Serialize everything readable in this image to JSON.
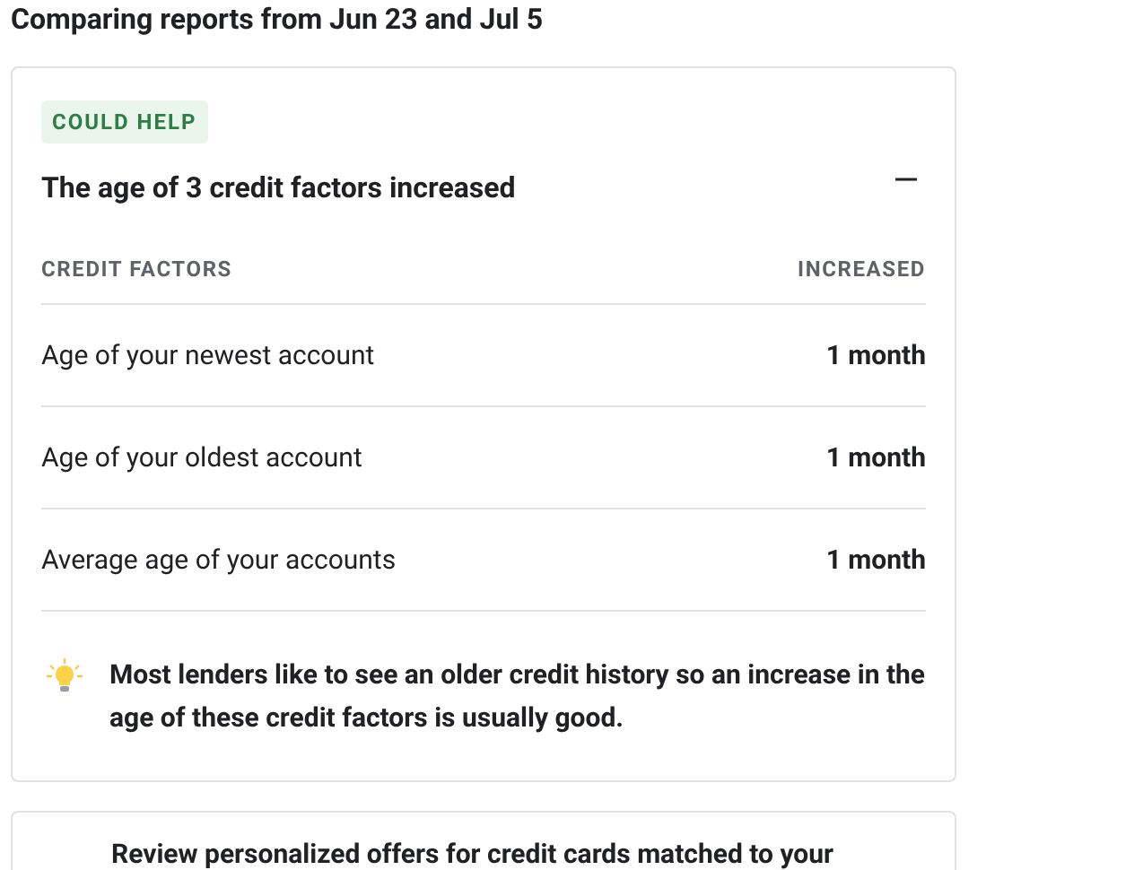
{
  "heading": "Comparing reports from Jun 23 and Jul 5",
  "card": {
    "badge": "COULD HELP",
    "title": "The age of 3 credit factors increased",
    "expanded": true,
    "columns": [
      "CREDIT FACTORS",
      "INCREASED"
    ],
    "rows": [
      {
        "factor": "Age of your newest account",
        "change": "1 month"
      },
      {
        "factor": "Age of your oldest account",
        "change": "1 month"
      },
      {
        "factor": "Average age of your accounts",
        "change": "1 month"
      }
    ],
    "tip": "Most lenders like to see an older credit history so an increase in the age of these credit factors is usually good."
  },
  "next_card": {
    "text": "Review personalized offers for credit cards matched to your"
  }
}
